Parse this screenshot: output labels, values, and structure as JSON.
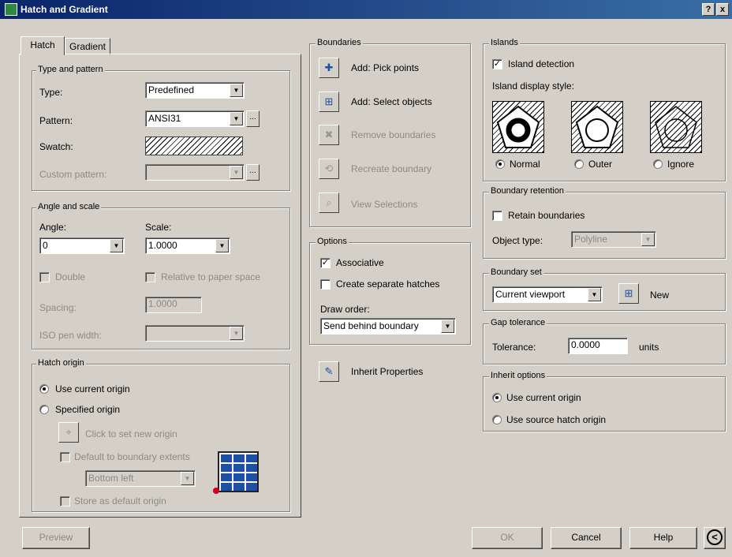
{
  "window": {
    "title": "Hatch and Gradient",
    "help_glyph": "?",
    "close_glyph": "x"
  },
  "tabs": [
    {
      "label": "Hatch"
    },
    {
      "label": "Gradient"
    }
  ],
  "type_pattern": {
    "title": "Type and pattern",
    "type_label": "Type:",
    "type_value": "Predefined",
    "pattern_label": "Pattern:",
    "pattern_value": "ANSI31",
    "swatch_label": "Swatch:",
    "custom_label": "Custom pattern:",
    "browse": "..."
  },
  "angle_scale": {
    "title": "Angle and scale",
    "angle_label": "Angle:",
    "angle_value": "0",
    "scale_label": "Scale:",
    "scale_value": "1.0000",
    "double_label": "Double",
    "relative_label": "Relative to paper space",
    "spacing_label": "Spacing:",
    "spacing_value": "1.0000",
    "iso_label": "ISO pen width:"
  },
  "hatch_origin": {
    "title": "Hatch origin",
    "use_current": "Use current origin",
    "specified": "Specified origin",
    "click_set": "Click to set new origin",
    "default_extents": "Default to boundary extents",
    "position_value": "Bottom left",
    "store_default": "Store as default origin"
  },
  "boundaries": {
    "title": "Boundaries",
    "add_pick": "Add: Pick points",
    "add_select": "Add: Select objects",
    "remove": "Remove boundaries",
    "recreate": "Recreate boundary",
    "view": "View Selections"
  },
  "options": {
    "title": "Options",
    "associative": "Associative",
    "separate": "Create separate hatches",
    "draw_order_label": "Draw order:",
    "draw_order_value": "Send behind boundary"
  },
  "inherit_properties": "Inherit Properties",
  "islands": {
    "title": "Islands",
    "detection": "Island detection",
    "display_style": "Island display style:",
    "normal": "Normal",
    "outer": "Outer",
    "ignore": "Ignore"
  },
  "boundary_retention": {
    "title": "Boundary retention",
    "retain": "Retain boundaries",
    "object_type_label": "Object type:",
    "object_type_value": "Polyline"
  },
  "boundary_set": {
    "title": "Boundary set",
    "value": "Current viewport",
    "new_label": "New"
  },
  "gap_tolerance": {
    "title": "Gap tolerance",
    "label": "Tolerance:",
    "value": "0.0000",
    "units": "units"
  },
  "inherit_options": {
    "title": "Inherit options",
    "use_current": "Use current origin",
    "use_source": "Use source hatch origin"
  },
  "footer": {
    "preview": "Preview",
    "ok": "OK",
    "cancel": "Cancel",
    "help": "Help",
    "more_glyph": "<"
  }
}
